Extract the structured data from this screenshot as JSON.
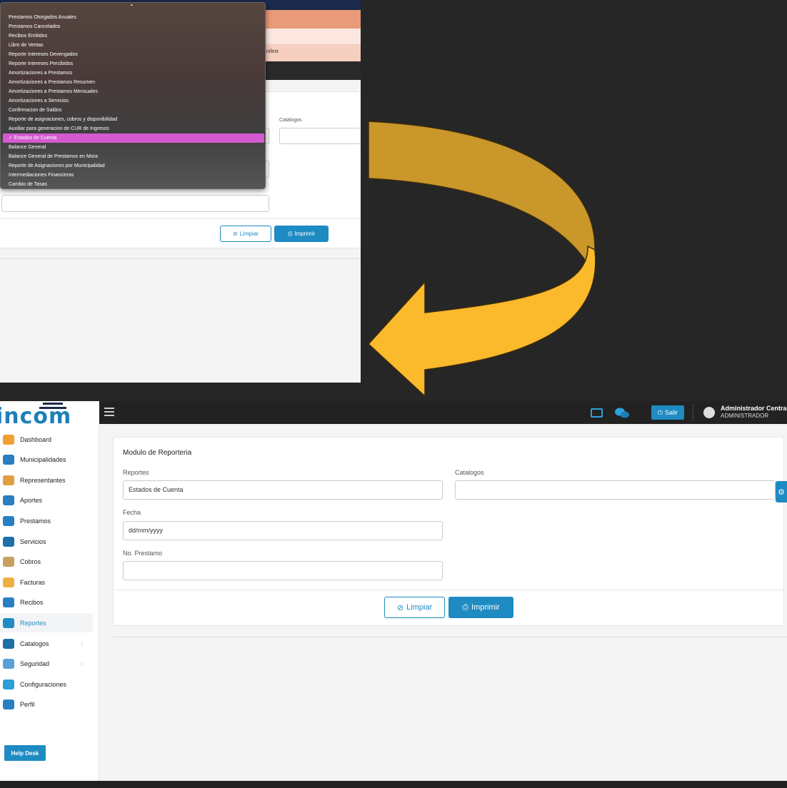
{
  "top_screenshot": {
    "partial_text": "nifest",
    "labels": {
      "catalogos": "Catalogos"
    },
    "buttons": {
      "limpiar": "Limpiar",
      "imprimir": "Imprimir"
    },
    "dropdown": {
      "selected": "Estados de Cuenta",
      "options": [
        "Prestamos Otorgados Anuales",
        "Prestamos Cancelados",
        "Recibos Emitidos",
        "Libro de Ventas",
        "Reporte Intereses Devengados",
        "Reporte Intereses Percibidos",
        "Amortizaciones a Prestamos",
        "Amortizaciones a Prestamos Resumen",
        "Amortizaciones a Prestamos Mensuales",
        "Amortizaciones a Servicios",
        "Confirmacion de Saldos",
        "Reporte de asignaciones, cobros y disponibilidad",
        "Auxiliar para generacion de CUR de Ingresos",
        "✓ Estados de Cuenta",
        "Balance General",
        "Balance General de Prestamos en Mora",
        "Reporte de Asignaciones por Municipalidad",
        "Intermediaciones Financieras",
        "Cambio de Tasas"
      ]
    }
  },
  "app": {
    "logo": "incom",
    "header": {
      "salir": "Salir",
      "user_name": "Administrador Central",
      "user_role": "ADMINISTRADOR"
    },
    "sidebar": {
      "items": [
        {
          "label": "Dashboard",
          "icon": "chart-icon",
          "color": "#f0a030"
        },
        {
          "label": "Municipalidades",
          "icon": "building-icon",
          "color": "#2a7fc0"
        },
        {
          "label": "Representantes",
          "icon": "users-icon",
          "color": "#e0a040"
        },
        {
          "label": "Aportes",
          "icon": "coins-icon",
          "color": "#2a7fc0"
        },
        {
          "label": "Prestamos",
          "icon": "cash-icon",
          "color": "#2a7fc0"
        },
        {
          "label": "Servicios",
          "icon": "layers-icon",
          "color": "#1e6fa8"
        },
        {
          "label": "Cobros",
          "icon": "moneybag-icon",
          "color": "#c8a060"
        },
        {
          "label": "Facturas",
          "icon": "invoice-icon",
          "color": "#f0b040"
        },
        {
          "label": "Recibos",
          "icon": "receipt-icon",
          "color": "#2a7fc0"
        },
        {
          "label": "Reportes",
          "icon": "printer-icon",
          "color": "#1e8bc3"
        },
        {
          "label": "Catalogos",
          "icon": "catalog-icon",
          "color": "#1e6fa8"
        },
        {
          "label": "Seguridad",
          "icon": "shield-icon",
          "color": "#5aa0d8"
        },
        {
          "label": "Configuraciones",
          "icon": "settings-icon",
          "color": "#2a9fd8"
        },
        {
          "label": "Perfil",
          "icon": "user-icon",
          "color": "#2a7fc0"
        }
      ],
      "active": "Reportes",
      "help_desk": "Help Desk"
    },
    "card": {
      "title": "Modulo de Reporteria",
      "reportes_label": "Reportes",
      "reportes_value": "Estados de Cuenta",
      "catalogos_label": "Catalogos",
      "fecha_label": "Fecha",
      "fecha_placeholder": "dd/mm/yyyy",
      "prestamo_label": "No. Prestamo",
      "limpiar": "Limpiar",
      "imprimir": "Imprimir"
    }
  },
  "colors": {
    "accent": "#1e8bc3",
    "highlight": "#d45ad0",
    "arrow_dark": "#c9972a",
    "arrow_light": "#fbb92c"
  }
}
